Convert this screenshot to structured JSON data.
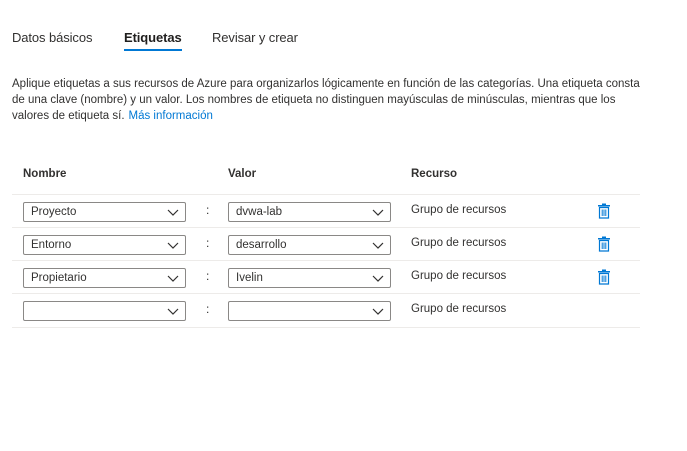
{
  "tabs": [
    {
      "label": "Datos básicos",
      "active": false
    },
    {
      "label": "Etiquetas",
      "active": true
    },
    {
      "label": "Revisar y crear",
      "active": false
    }
  ],
  "description": {
    "text": "Aplique etiquetas a sus recursos de Azure para organizarlos lógicamente en función de las categorías. Una etiqueta consta de una clave (nombre) y un valor. Los nombres de etiqueta no distinguen mayúsculas de minúsculas, mientras que los valores de etiqueta sí.",
    "link": "Más información"
  },
  "table": {
    "headers": {
      "name": "Nombre",
      "value": "Valor",
      "resource": "Recurso"
    },
    "rows": [
      {
        "name": "Proyecto",
        "value": "dvwa-lab",
        "resource": "Grupo de recursos"
      },
      {
        "name": "Entorno",
        "value": "desarrollo",
        "resource": "Grupo de recursos"
      },
      {
        "name": "Propietario",
        "value": "Ivelin",
        "resource": "Grupo de recursos"
      },
      {
        "name": "",
        "value": "",
        "resource": "Grupo de recursos"
      }
    ],
    "colon": ":"
  },
  "colors": {
    "accent": "#0078d4",
    "text": "#323130",
    "border": "#8a8886"
  }
}
